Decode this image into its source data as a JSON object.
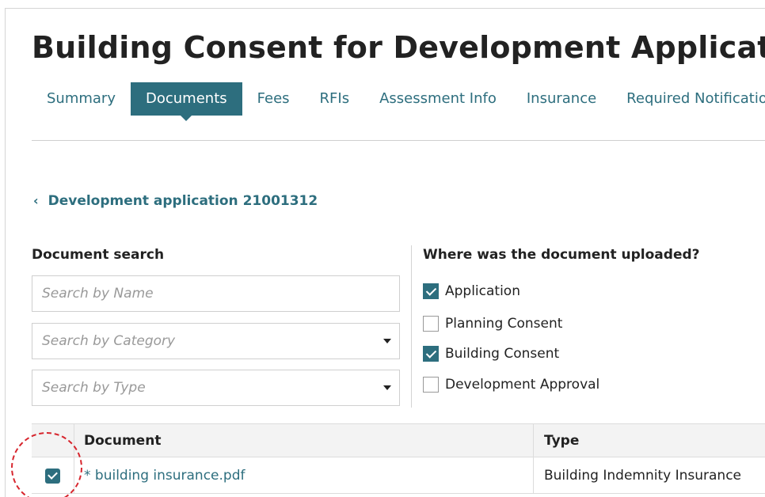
{
  "page": {
    "title": "Building Consent for Development Application:"
  },
  "tabs": [
    {
      "label": "Summary",
      "active": false
    },
    {
      "label": "Documents",
      "active": true
    },
    {
      "label": "Fees",
      "active": false
    },
    {
      "label": "RFIs",
      "active": false
    },
    {
      "label": "Assessment Info",
      "active": false
    },
    {
      "label": "Insurance",
      "active": false
    },
    {
      "label": "Required Notification",
      "active": false
    }
  ],
  "back_link": {
    "label": "Development application 21001312"
  },
  "document_search": {
    "heading": "Document search",
    "name_placeholder": "Search by Name",
    "category_placeholder": "Search by Category",
    "type_placeholder": "Search by Type"
  },
  "upload_filter": {
    "heading": "Where was the document uploaded?",
    "options": [
      {
        "label": "Application",
        "checked": true
      },
      {
        "label": "Planning Consent",
        "checked": false
      },
      {
        "label": "Building Consent",
        "checked": true
      },
      {
        "label": "Development Approval",
        "checked": false
      }
    ]
  },
  "table": {
    "headers": {
      "document": "Document",
      "type": "Type"
    },
    "rows": [
      {
        "selected": true,
        "document": "* building insurance.pdf",
        "type": "Building Indemnity Insurance"
      }
    ]
  },
  "colors": {
    "accent": "#2d6e7e",
    "highlight": "#d7262e"
  }
}
